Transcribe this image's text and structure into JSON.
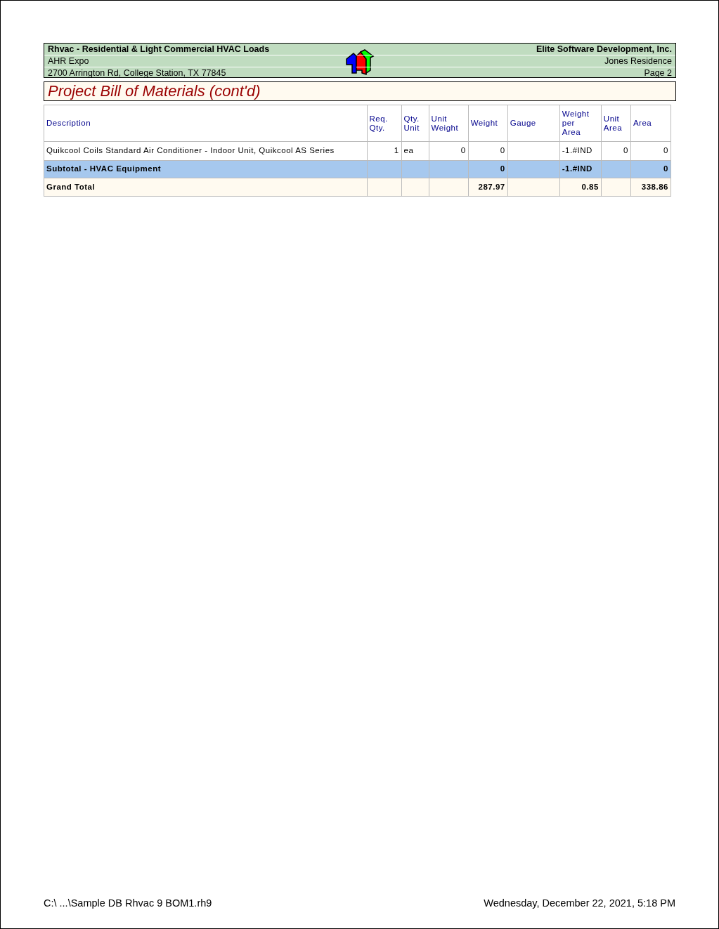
{
  "header": {
    "left": [
      "Rhvac - Residential & Light Commercial HVAC Loads",
      "AHR Expo",
      "2700 Arrington Rd, College Station, TX 77845"
    ],
    "right": [
      "Elite Software Development, Inc.",
      "Jones Residence",
      "Page 2"
    ]
  },
  "title": "Project Bill of Materials (cont'd)",
  "table": {
    "columns": [
      "Description",
      "Req. Qty.",
      "Qty. Unit",
      "Unit Weight",
      "Weight",
      "Gauge",
      "Weight per Area",
      "Unit Area",
      "Area"
    ],
    "rows": [
      {
        "kind": "item",
        "cells": [
          "Quikcool Coils Standard Air Conditioner - Indoor Unit, Quikcool AS Series",
          "1",
          "ea",
          "0",
          "0",
          null,
          "-1.#IND",
          "0",
          "0"
        ]
      },
      {
        "kind": "subtotal",
        "cells": [
          "Subtotal - HVAC Equipment",
          null,
          null,
          null,
          "0",
          null,
          "-1.#IND",
          null,
          "0"
        ]
      },
      {
        "kind": "total",
        "cells": [
          "Grand Total",
          null,
          null,
          null,
          "287.97",
          null,
          "0.85",
          null,
          "338.86"
        ]
      }
    ]
  },
  "footer": {
    "file": "C:\\ ...\\Sample DB Rhvac 9 BOM1.rh9",
    "date": "Wednesday, December 22, 2021, 5:18 PM"
  }
}
